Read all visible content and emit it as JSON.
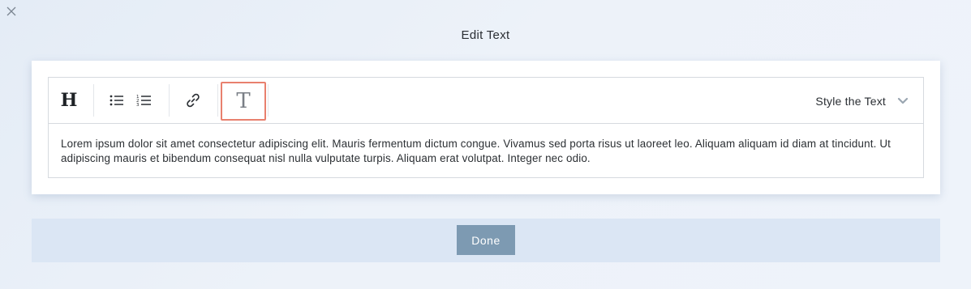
{
  "dialog": {
    "title": "Edit Text",
    "close_icon": "close-icon"
  },
  "toolbar": {
    "heading_label": "H",
    "heading_icon": "heading-icon",
    "bullet_list_icon": "bullet-list-icon",
    "numbered_list_icon": "numbered-list-icon",
    "link_icon": "link-icon",
    "text_style_icon": "text-style-icon",
    "text_style_label": "T",
    "style_select_label": "Style the Text",
    "style_select_icon": "chevron-down-icon",
    "accent_color": "#e8806e"
  },
  "editor": {
    "content": "Lorem ipsum dolor sit amet consectetur adipiscing elit. Mauris fermentum dictum congue. Vivamus sed porta risus ut laoreet leo. Aliquam aliquam id diam at tincidunt. Ut adipiscing mauris et bibendum consequat nisl nulla vulputate turpis. Aliquam erat volutpat. Integer nec odio."
  },
  "footer": {
    "done_label": "Done",
    "done_color": "#7d9ab2"
  }
}
